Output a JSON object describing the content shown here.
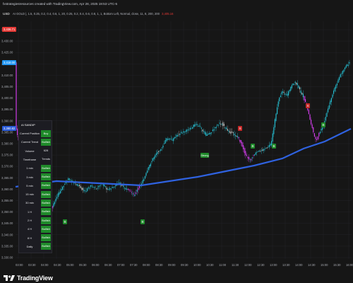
{
  "topbar": {
    "header_text": "fxstrategiesresources created with TradingView.com, Apr 28, 2025 19:53 UTC-5"
  },
  "infobar": {
    "symbol": "USD",
    "params": "AI GOLD  |, 1.5, 0.25, 0.2, 0.4, 0.6, 1, 20, 0.25, 0.2, 0.4, 0.6, 0.8, 1, 1, Bottom Left, Normal, close, 11, 8, 200, 200",
    "value": "3,405.16"
  },
  "price_axis": {
    "labels": [
      "3,436.71",
      "3,430.00",
      "3,425.00",
      "3,418.00",
      "3,410.00",
      "3,405.00",
      "3,400.00",
      "3,395.00",
      "3,390.00",
      "3,385.00",
      "3,380.00",
      "3,375.00",
      "3,370.00",
      "3,365.00",
      "3,360.00",
      "3,355.00",
      "3,350.00",
      "3,345.00",
      "3,340.00",
      "3,335.00",
      "3,330.00"
    ],
    "current_price_label": "3,436.71",
    "current_price_color": "#e53935",
    "marker_label": "3,418.00",
    "marker_color": "#2196f3",
    "ma_label": "3,380.82",
    "ma_color": "#2a5bd7"
  },
  "time_axis": {
    "labels": [
      "03:00",
      "03:30",
      "04:00",
      "04:30",
      "05:00",
      "05:30",
      "06:00",
      "06:30",
      "07:00",
      "07:30",
      "08:00",
      "08:30",
      "09:00",
      "09:30",
      "10:00",
      "10:30",
      "11:00",
      "11:30",
      "12:00",
      "12:30",
      "13:00",
      "13:30",
      "14:00",
      "14:30",
      "15:00",
      "15:30",
      "16:00"
    ]
  },
  "panel": {
    "title": "AI SANDIP",
    "rows": [
      {
        "label": "Current Position",
        "value": "Buy"
      },
      {
        "label": "Current Trend",
        "value": "Bullish"
      },
      {
        "label": "Volume",
        "value": "628"
      },
      {
        "label": "Timeframe",
        "value": "Trends"
      },
      {
        "label": "1 min",
        "value": "Bullish"
      },
      {
        "label": "3 min",
        "value": "Bullish"
      },
      {
        "label": "5 min",
        "value": "Bullish"
      },
      {
        "label": "15 min",
        "value": "Bullish"
      },
      {
        "label": "30 min",
        "value": "Bullish"
      },
      {
        "label": "1 H",
        "value": "Bullish"
      },
      {
        "label": "2 H",
        "value": "Bullish"
      },
      {
        "label": "4 H",
        "value": "Bullish"
      },
      {
        "label": "8 H",
        "value": "Bullish"
      },
      {
        "label": "Daily",
        "value": "Bullish"
      }
    ]
  },
  "signals": {
    "buy_label": "B",
    "sell_label": "S",
    "strong_label": "Strong"
  },
  "colors": {
    "bull_candle": "#26c6da",
    "bear_candle": "#e040fb",
    "neutral_candle": "#c8c8c8",
    "ma_line": "#2f62e0",
    "buy_signal": "#1f8a2a",
    "sell_signal": "#c62828"
  },
  "footer": {
    "brand": "TradingView"
  }
}
